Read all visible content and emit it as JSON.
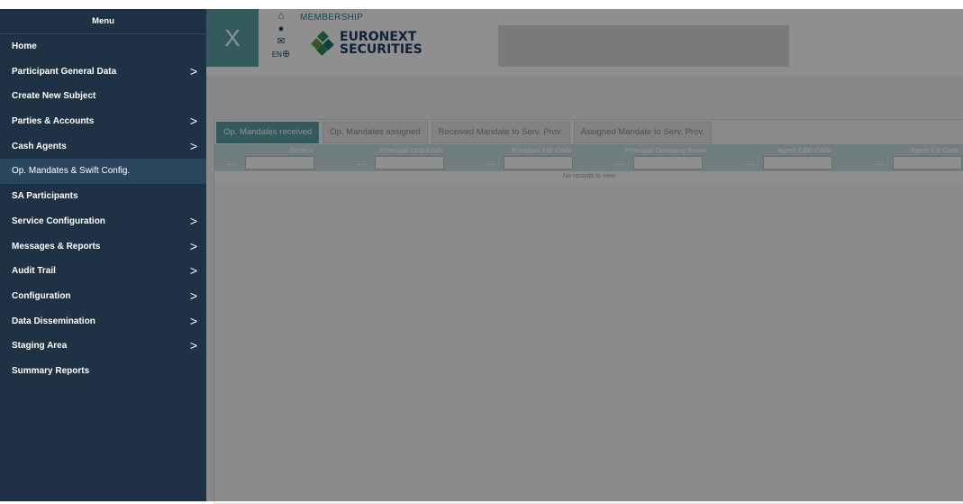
{
  "header": {
    "close_label": "X",
    "icons": [
      "home-icon",
      "info-icon",
      "mail-icon",
      "globe-icon"
    ],
    "lang": "EN",
    "section": "MEMBERSHIP",
    "logo_line1": "EURONEXT",
    "logo_line2": "SECURITIES"
  },
  "tabs": [
    {
      "label": "Op. Mandates received",
      "active": true
    },
    {
      "label": "Op. Mandates assigned"
    },
    {
      "label": "Received Mandate to Serv. Prov."
    },
    {
      "label": "Assigned Mandate to Serv. Prov."
    }
  ],
  "grid": {
    "columns": [
      "Service",
      "Principal CED Code",
      "Principal ABI Code",
      "Principal Company Name",
      "Agent CED Code",
      "Agent CS Code"
    ],
    "filter_op": "==",
    "empty_text": "No records to view"
  },
  "sidebar": {
    "title": "Menu",
    "items": [
      {
        "label": "Home",
        "arrow": ""
      },
      {
        "label": "Participant General Data",
        "arrow": ">"
      },
      {
        "label": "Create New Subject",
        "arrow": ""
      },
      {
        "label": "Parties & Accounts",
        "arrow": ">"
      },
      {
        "label": "Cash Agents",
        "arrow": ">"
      },
      {
        "label": "Op. Mandates & Swift Config.",
        "arrow": "",
        "active": true
      },
      {
        "label": "SA Participants",
        "arrow": ""
      },
      {
        "label": "Service Configuration",
        "arrow": ">"
      },
      {
        "label": "Messages & Reports",
        "arrow": ">"
      },
      {
        "label": "Audit Trail",
        "arrow": ">"
      },
      {
        "label": "Configuration",
        "arrow": ">"
      },
      {
        "label": "Data Dissemination",
        "arrow": ">"
      },
      {
        "label": "Staging Area",
        "arrow": ">"
      },
      {
        "label": "Summary Reports",
        "arrow": ""
      }
    ]
  },
  "colors": {
    "sidebar_bg": "#1f3245",
    "accent": "#5ba3a8",
    "brand": "#1a3f66"
  }
}
